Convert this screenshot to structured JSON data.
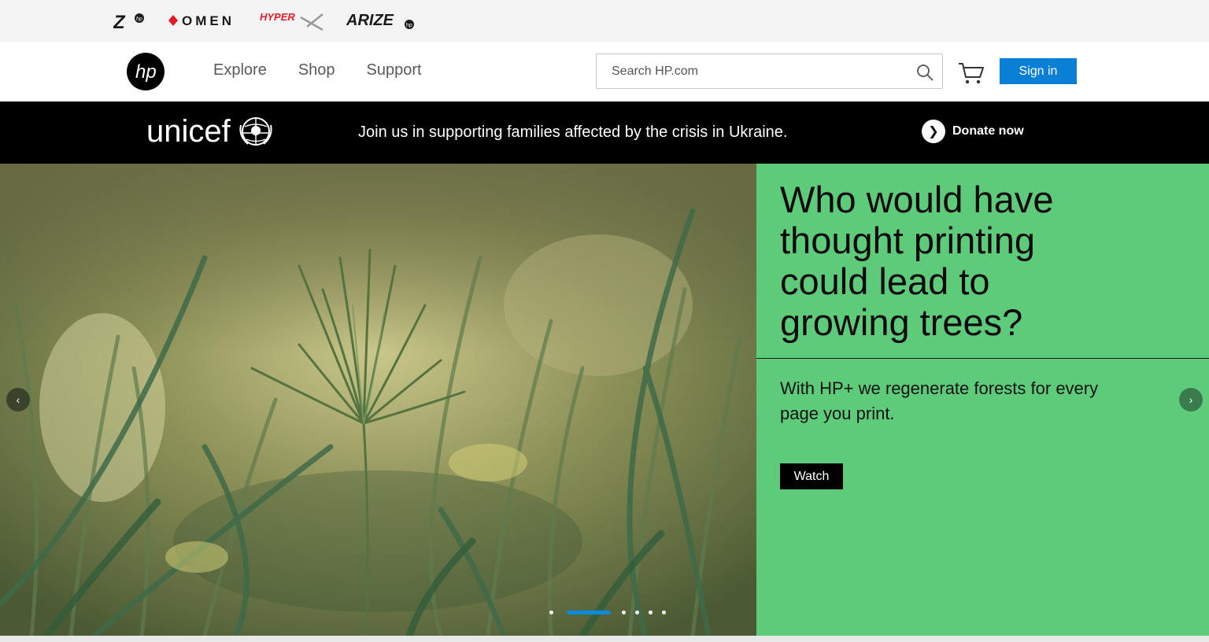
{
  "brands": {
    "z_label": "Z",
    "z_hp": "hp",
    "omen_label": "OMEN",
    "hyperx_label": "HYPER",
    "arize_label": "ARIZE",
    "arize_hp": "hp"
  },
  "header": {
    "logo_text": "hp",
    "nav": [
      {
        "label": "Explore"
      },
      {
        "label": "Shop"
      },
      {
        "label": "Support"
      }
    ],
    "search_placeholder": "Search HP.com",
    "sign_in_label": "Sign in",
    "icons": {
      "search": "search-icon",
      "cart": "cart-icon"
    },
    "accent_color": "#0a7fd6"
  },
  "banner": {
    "logo_text": "unicef",
    "message": "Join us in supporting families affected by the crisis in Ukraine.",
    "donate_label": "Donate now",
    "donate_icon": "chevron-right-icon"
  },
  "hero": {
    "title": "Who would have thought printing could lead to growing trees?",
    "subtitle": "With HP+ we regenerate forests for every page you print.",
    "cta_label": "Watch",
    "panel_color": "#5ecb7a",
    "prev_icon": "‹",
    "next_icon": "›",
    "slide_count": 6,
    "active_slide": 2
  }
}
